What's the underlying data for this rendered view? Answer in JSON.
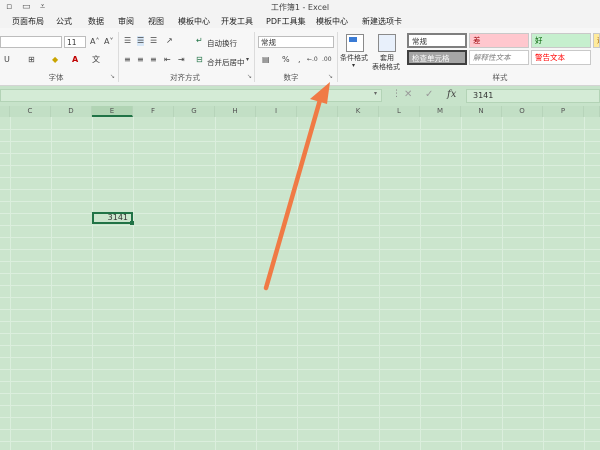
{
  "window": {
    "title": "工作簿1 - Excel"
  },
  "tabs": [
    "页面布局",
    "公式",
    "数据",
    "审阅",
    "视图",
    "模板中心",
    "开发工具",
    "PDF工具集",
    "模板中心",
    "新建选项卡"
  ],
  "ribbon": {
    "font": {
      "size": "11",
      "group_label": "字体"
    },
    "alignment": {
      "wrap_text": "自动换行",
      "merge_center": "合并后居中",
      "group_label": "对齐方式"
    },
    "number": {
      "format": "常规",
      "percent": "%",
      "group_label": "数字"
    },
    "styles": {
      "conditional_format": "条件格式",
      "table_format_line1": "套用",
      "table_format_line2": "表格格式",
      "cells_row1": [
        "常规",
        "差",
        "好",
        "适"
      ],
      "cells_row2": [
        "检查单元格",
        "解释性文本",
        "警告文本"
      ],
      "group_label": "样式"
    }
  },
  "formula_bar": {
    "value": "3141",
    "fx_label": "fx"
  },
  "sheet": {
    "columns": [
      "C",
      "D",
      "E",
      "F",
      "G",
      "H",
      "I",
      "J",
      "K",
      "L",
      "M",
      "N",
      "O",
      "P"
    ],
    "active_cell_value": "3141"
  },
  "colors": {
    "accent": "#217346",
    "annotation_arrow": "#f07a45",
    "sheet_bg": "#cbe5cd"
  }
}
